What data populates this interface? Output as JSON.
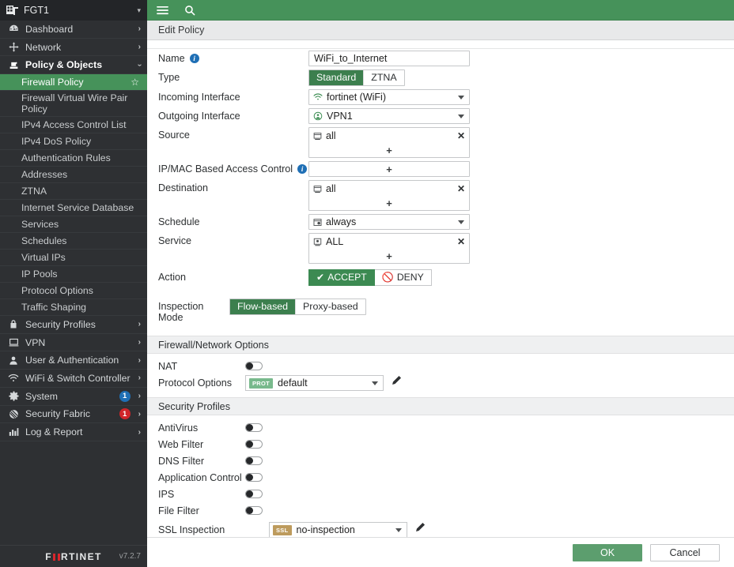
{
  "colors": {
    "header_green": "#46925a",
    "selected_green": "#46925a",
    "accept_green": "#3c8a52",
    "sidebar_bg": "#2e3033",
    "badge_blue": "#1f6fb5",
    "badge_red": "#d0252a",
    "prot_tag": "#78b98c",
    "ssl_tag": "#bd9b5d"
  },
  "sidebar": {
    "device": {
      "name": "FGT1",
      "icon": "device-icon",
      "caret": "▾"
    },
    "items": [
      {
        "label": "Dashboard",
        "icon": "dashboard-icon",
        "arrow": "›",
        "type": "group"
      },
      {
        "label": "Network",
        "icon": "network-icon",
        "arrow": "›",
        "type": "group"
      },
      {
        "label": "Policy & Objects",
        "icon": "policy-icon",
        "arrow": "›",
        "type": "group",
        "expanded": true
      }
    ],
    "sub_items": [
      {
        "label": "Firewall Policy",
        "selected": true,
        "star": "☆"
      },
      {
        "label": "Firewall Virtual Wire Pair Policy",
        "two_line": true
      },
      {
        "label": "IPv4 Access Control List"
      },
      {
        "label": "IPv4 DoS Policy"
      },
      {
        "label": "Authentication Rules"
      },
      {
        "label": "Addresses"
      },
      {
        "label": "ZTNA"
      },
      {
        "label": "Internet Service Database"
      },
      {
        "label": "Services"
      },
      {
        "label": "Schedules"
      },
      {
        "label": "Virtual IPs"
      },
      {
        "label": "IP Pools"
      },
      {
        "label": "Protocol Options"
      },
      {
        "label": "Traffic Shaping"
      }
    ],
    "items_bottom": [
      {
        "label": "Security Profiles",
        "icon": "lock-icon",
        "arrow": "›"
      },
      {
        "label": "VPN",
        "icon": "monitor-icon",
        "arrow": "›"
      },
      {
        "label": "User & Authentication",
        "icon": "user-icon",
        "arrow": "›"
      },
      {
        "label": "WiFi & Switch Controller",
        "icon": "wifi-icon",
        "arrow": "›"
      },
      {
        "label": "System",
        "icon": "gear-icon",
        "arrow": "›",
        "badge": "1",
        "badge_color": "blue"
      },
      {
        "label": "Security Fabric",
        "icon": "fabric-icon",
        "arrow": "›",
        "badge": "1",
        "badge_color": "red"
      },
      {
        "label": "Log & Report",
        "icon": "chart-icon",
        "arrow": "›"
      }
    ],
    "brand": {
      "name": "FORTINET",
      "version": "v7.2.7"
    }
  },
  "topbar": {
    "menu_icon": "hamburger-icon",
    "search_icon": "search-icon"
  },
  "breadcrumb": {
    "title": "Edit Policy"
  },
  "form": {
    "name": {
      "label": "Name",
      "value": "WiFi_to_Internet",
      "info": true
    },
    "type": {
      "label": "Type",
      "options": [
        "Standard",
        "ZTNA"
      ],
      "selected": "Standard"
    },
    "incoming_interface": {
      "label": "Incoming Interface",
      "value": "fortinet (WiFi)",
      "icon": "wifi-icon"
    },
    "outgoing_interface": {
      "label": "Outgoing Interface",
      "value": "VPN1",
      "icon": "vpn-icon"
    },
    "source": {
      "label": "Source",
      "entries": [
        {
          "text": "all",
          "icon": "address-icon"
        }
      ],
      "add": "+"
    },
    "ipmac": {
      "label": "IP/MAC Based Access Control",
      "info": true,
      "entries": [],
      "add": "+"
    },
    "destination": {
      "label": "Destination",
      "entries": [
        {
          "text": "all",
          "icon": "address-icon"
        }
      ],
      "add": "+"
    },
    "schedule": {
      "label": "Schedule",
      "value": "always",
      "icon": "schedule-icon"
    },
    "service": {
      "label": "Service",
      "entries": [
        {
          "text": "ALL",
          "icon": "service-icon"
        }
      ],
      "add": "+"
    },
    "action": {
      "label": "Action",
      "accept": "ACCEPT",
      "deny": "DENY",
      "selected": "ACCEPT"
    },
    "inspection_mode": {
      "label": "Inspection Mode",
      "options": [
        "Flow-based",
        "Proxy-based"
      ],
      "selected": "Flow-based"
    }
  },
  "firewall_network_options": {
    "heading": "Firewall/Network Options",
    "nat": {
      "label": "NAT",
      "enabled": false
    },
    "protocol_options": {
      "label": "Protocol Options",
      "tag": "PROT",
      "value": "default",
      "edit_icon": "pencil-icon"
    }
  },
  "security_profiles": {
    "heading": "Security Profiles",
    "toggles": [
      {
        "label": "AntiVirus",
        "enabled": false
      },
      {
        "label": "Web Filter",
        "enabled": false
      },
      {
        "label": "DNS Filter",
        "enabled": false
      },
      {
        "label": "Application Control",
        "enabled": false
      },
      {
        "label": "IPS",
        "enabled": false
      },
      {
        "label": "File Filter",
        "enabled": false
      }
    ],
    "ssl_inspection": {
      "label": "SSL Inspection",
      "tag": "SSL",
      "value": "no-inspection",
      "edit_icon": "pencil-icon"
    }
  },
  "footer": {
    "ok": "OK",
    "cancel": "Cancel"
  }
}
